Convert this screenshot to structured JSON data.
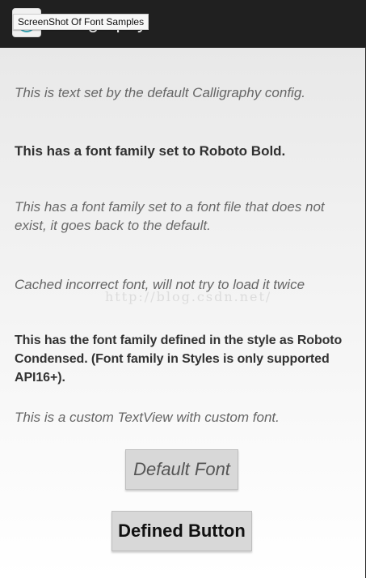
{
  "tooltip": "ScreenShot Of Font Samples",
  "app": {
    "title": "Calligraphy",
    "icon": "calligraphy-app-icon"
  },
  "samples": {
    "default_config": "This is text set by the default Calligraphy config.",
    "roboto_bold": "This has a font family set to Roboto Bold.",
    "missing_font": "This has a font family set to a font file that does not exist, it goes back to the default.",
    "cached_incorrect": "Cached incorrect font, will not try to load it twice",
    "style_defined": "This has the font family defined in the style as Roboto Condensed. (Font family in Styles is only supported API16+).",
    "custom_textview": "This is a custom TextView with custom font."
  },
  "watermark": "http://blog.csdn.net/",
  "buttons": {
    "default_font": "Default Font",
    "defined_button": "Defined Button"
  },
  "colors": {
    "action_bar": "#202020",
    "button_background": "#d8d8d8"
  }
}
